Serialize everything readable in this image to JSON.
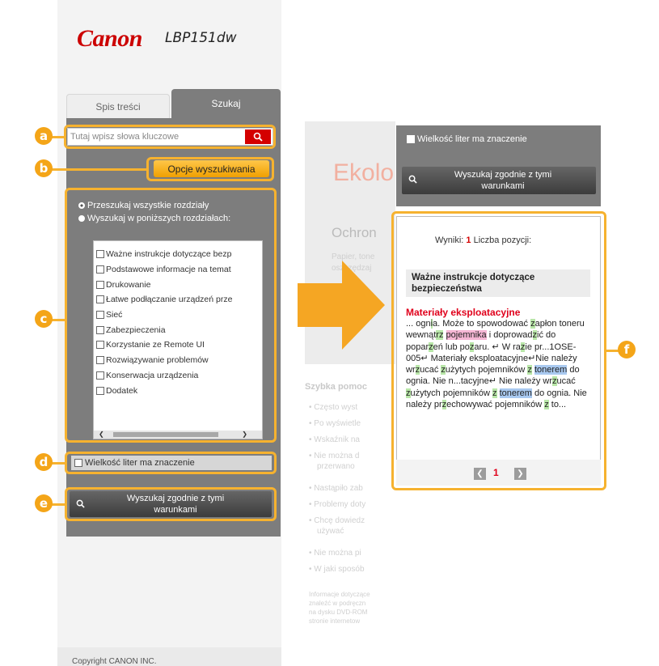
{
  "brand": {
    "logo": "Canon",
    "model": "LBP151dw"
  },
  "tabs": [
    {
      "label": "Spis treści"
    },
    {
      "label": "Szukaj"
    }
  ],
  "search": {
    "placeholder": "Tutaj wpisz słowa kluczowe"
  },
  "options_button": "Opcje wyszukiwania",
  "scope": {
    "all": "Przeszukaj wszystkie rozdziały",
    "selected": "Wyszukaj w poniższych rozdziałach:"
  },
  "chapters": [
    "Ważne instrukcje dotyczące bezp",
    "Podstawowe informacje na temat",
    "Drukowanie",
    "Łatwe podłączanie urządzeń prze",
    "Sieć",
    "Zabezpieczenia",
    "Korzystanie ze Remote UI",
    "Rozwiązywanie problemów",
    "Konserwacja urządzenia",
    "Dodatek"
  ],
  "case_sensitive": "Wielkość liter ma znaczenie",
  "search_conditions_button": "Wyszukaj zgodnie z tymi warunkami",
  "footer": "Copyright CANON INC.",
  "middle_page": {
    "title": "Ekolo",
    "subtitle": "Ochron",
    "text_lines": [
      "Papier, tone",
      "oszczędzaj"
    ],
    "section": "Szybka pomoc",
    "bullets": [
      "Często wyst",
      "Po wyświetle",
      "Wskaźnik na",
      "Nie można d",
      "przerwano",
      "Nastąpiło zab",
      "Problemy doty",
      "Chcę dowiedz",
      "używać",
      "Nie można pi",
      "W jaki sposób"
    ],
    "note_lines": [
      "Informacje dotyczące",
      "znaleźć w podręczn",
      "na dysku DVD-ROM",
      "stronie internetow"
    ]
  },
  "results": {
    "case_sensitive": "Wielkość liter ma znaczenie",
    "button": "Wyszukaj zgodnie z tymi warunkami",
    "count_label": "Wyniki:",
    "count_value": "1",
    "count_suffix": "Liczba pozycji:",
    "section_title": "Ważne instrukcje dotyczące bezpieczeństwa",
    "link": "Materiały eksploatacyjne",
    "page": "1"
  },
  "callouts": [
    "a",
    "b",
    "c",
    "d",
    "e",
    "f"
  ],
  "colors": {
    "accent": "#f4a518",
    "brand_red": "#cc0000",
    "panel_gray": "#7d7d7d"
  }
}
